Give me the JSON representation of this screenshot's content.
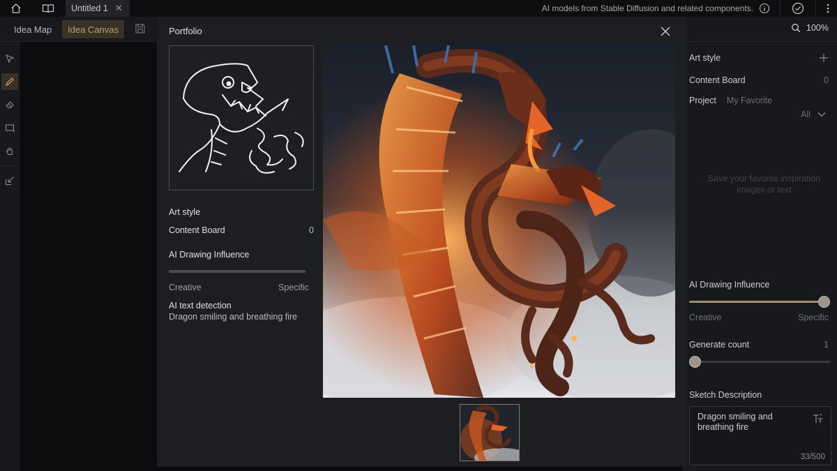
{
  "titlebar": {
    "tab_title": "Untitled 1",
    "tab_close": "✕",
    "message": "AI models from Stable Diffusion and related components."
  },
  "toolbar": {
    "tab_map": "Idea Map",
    "tab_canvas": "Idea Canvas",
    "zoom": "100%"
  },
  "right_panel": {
    "art_style": "Art style",
    "content_board": "Content Board",
    "content_board_count": "0",
    "project_label": "Project",
    "project_value": "My Favorite",
    "filter": "All",
    "empty_hint": "Save your favorite inspiration images or text",
    "influence_label": "AI Drawing Influence",
    "influence_value": 1.0,
    "creative": "Creative",
    "specific": "Specific",
    "generate_count_label": "Generate count",
    "generate_count": "1",
    "sketch_desc_label": "Sketch Description",
    "sketch_desc_text": "Dragon smiling and breathing fire",
    "char_count": "33/500"
  },
  "modal": {
    "title": "Portfolio",
    "art_style": "Art style",
    "content_board": "Content Board",
    "content_board_count": "0",
    "influence_label": "AI Drawing Influence",
    "creative": "Creative",
    "specific": "Specific",
    "text_detect_label": "AI text detection",
    "text_detect_value": "Dragon smiling and breathing fire"
  },
  "colors": {
    "accent": "#a58b6e",
    "active_tab_bg": "#3a3126",
    "panel_bg": "#18191c",
    "modal_bg": "#1c1e21"
  }
}
